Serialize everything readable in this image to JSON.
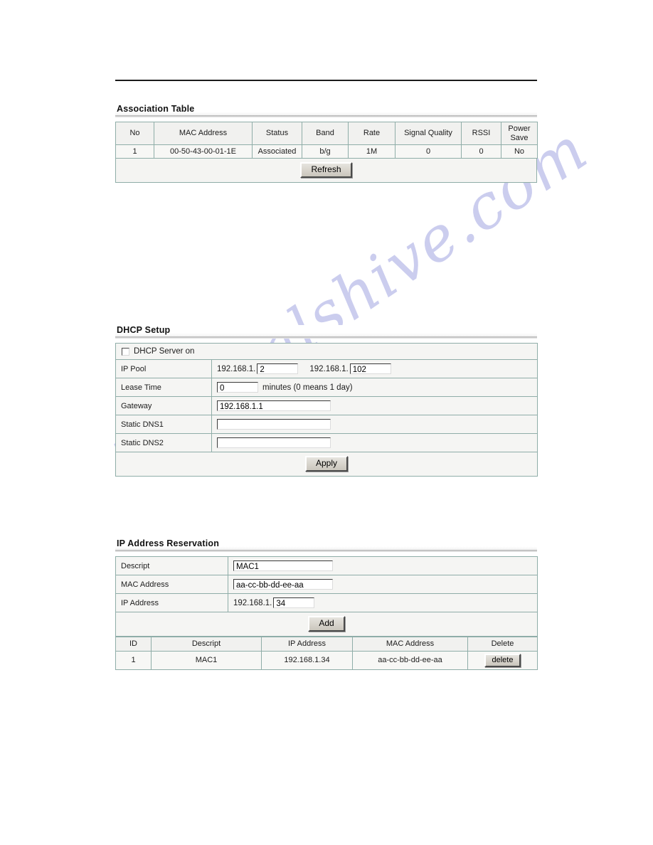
{
  "watermark": {
    "text": "manualshive.com"
  },
  "sections": {
    "association": {
      "heading": "Association Table",
      "columns": [
        "No",
        "MAC Address",
        "Status",
        "Band",
        "Rate",
        "Signal Quality",
        "RSSI",
        "Power Save"
      ],
      "rows": [
        {
          "no": "1",
          "mac_address": "00-50-43-00-01-1E",
          "status": "Associated",
          "band": "b/g",
          "rate": "1M",
          "signal_quality": "0",
          "rssi": "0",
          "power_save": "No"
        }
      ],
      "refresh_label": "Refresh"
    },
    "dhcp": {
      "heading": "DHCP Setup",
      "server_on_label": "DHCP Server on",
      "server_on_checked": false,
      "ip_pool": {
        "label": "IP Pool",
        "start_prefix": "192.168.1.",
        "start_value": "2",
        "end_prefix": "192.168.1.",
        "end_value": "102"
      },
      "lease_time": {
        "label": "Lease Time",
        "value": "0",
        "note": "minutes (0 means 1 day)"
      },
      "gateway": {
        "label": "Gateway",
        "value": "192.168.1.1"
      },
      "dns1": {
        "label": "Static DNS1",
        "value": ""
      },
      "dns2": {
        "label": "Static DNS2",
        "value": ""
      },
      "apply_label": "Apply"
    },
    "reservation": {
      "heading": "IP Address Reservation",
      "descript": {
        "label": "Descript",
        "value": "MAC1"
      },
      "mac_address": {
        "label": "MAC Address",
        "value": "aa-cc-bb-dd-ee-aa"
      },
      "ip_address": {
        "label": "IP Address",
        "prefix": "192.168.1.",
        "value": "34"
      },
      "add_label": "Add",
      "columns": [
        "ID",
        "Descript",
        "IP Address",
        "MAC Address",
        "Delete"
      ],
      "rows": [
        {
          "id": "1",
          "descript": "MAC1",
          "ip_address": "192.168.1.34",
          "mac_address": "aa-cc-bb-dd-ee-aa",
          "delete_label": "delete"
        }
      ]
    }
  },
  "colors": {
    "table_border": "#8fada8",
    "panel_bg": "#f7f7f5",
    "heading_rule": "#b4b4b4",
    "watermark": "#c9cbee",
    "button_face": "#d4d0c8"
  }
}
